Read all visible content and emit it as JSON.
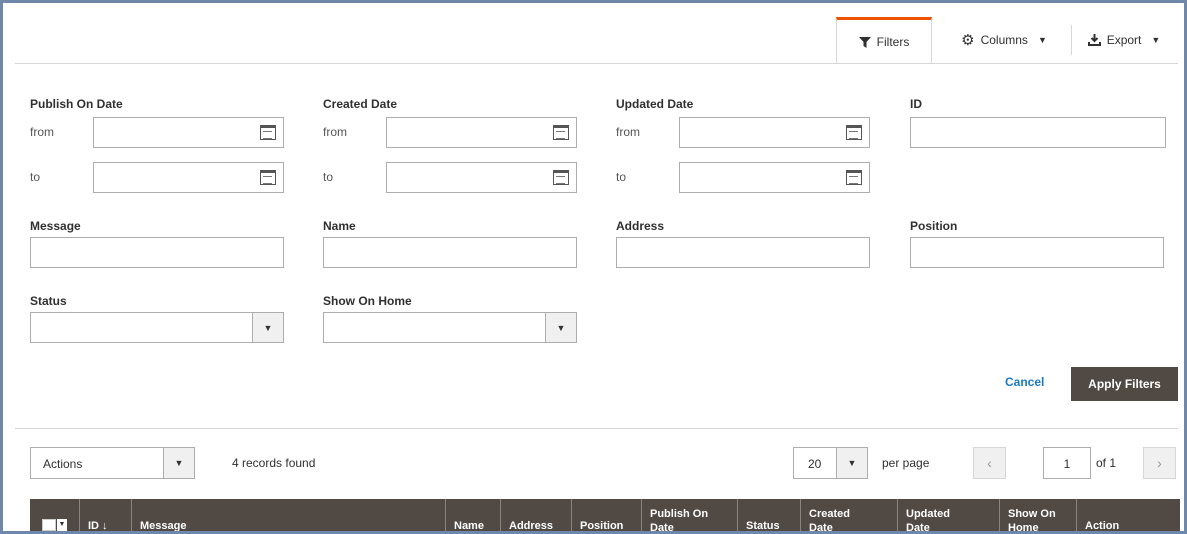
{
  "toolbar": {
    "filters_label": "Filters",
    "columns_label": "Columns",
    "export_label": "Export"
  },
  "filters": {
    "publish_on_date": {
      "label": "Publish On Date",
      "from": "from",
      "to": "to"
    },
    "created_date": {
      "label": "Created Date",
      "from": "from",
      "to": "to"
    },
    "updated_date": {
      "label": "Updated Date",
      "from": "from",
      "to": "to"
    },
    "id": {
      "label": "ID"
    },
    "message": {
      "label": "Message"
    },
    "name": {
      "label": "Name"
    },
    "address": {
      "label": "Address"
    },
    "position": {
      "label": "Position"
    },
    "status": {
      "label": "Status"
    },
    "show_on_home": {
      "label": "Show On Home"
    },
    "cancel_label": "Cancel",
    "apply_label": "Apply Filters"
  },
  "grid": {
    "actions_label": "Actions",
    "records_found": "4 records found",
    "per_page_value": "20",
    "per_page_label": "per page",
    "page_current": "1",
    "page_of": "of 1",
    "columns": [
      {
        "line1": "ID ↓",
        "line2": ""
      },
      {
        "line1": "Message",
        "line2": ""
      },
      {
        "line1": "Name",
        "line2": ""
      },
      {
        "line1": "Address",
        "line2": ""
      },
      {
        "line1": "Position",
        "line2": ""
      },
      {
        "line1": "Publish On",
        "line2": "Date"
      },
      {
        "line1": "Status",
        "line2": ""
      },
      {
        "line1": "Created",
        "line2": "Date"
      },
      {
        "line1": "Updated",
        "line2": "Date"
      },
      {
        "line1": "Show On",
        "line2": "Home"
      },
      {
        "line1": "Action",
        "line2": ""
      }
    ]
  },
  "colors": {
    "accent": "#eb5202",
    "header_bg": "#514943",
    "link": "#1979c3"
  }
}
